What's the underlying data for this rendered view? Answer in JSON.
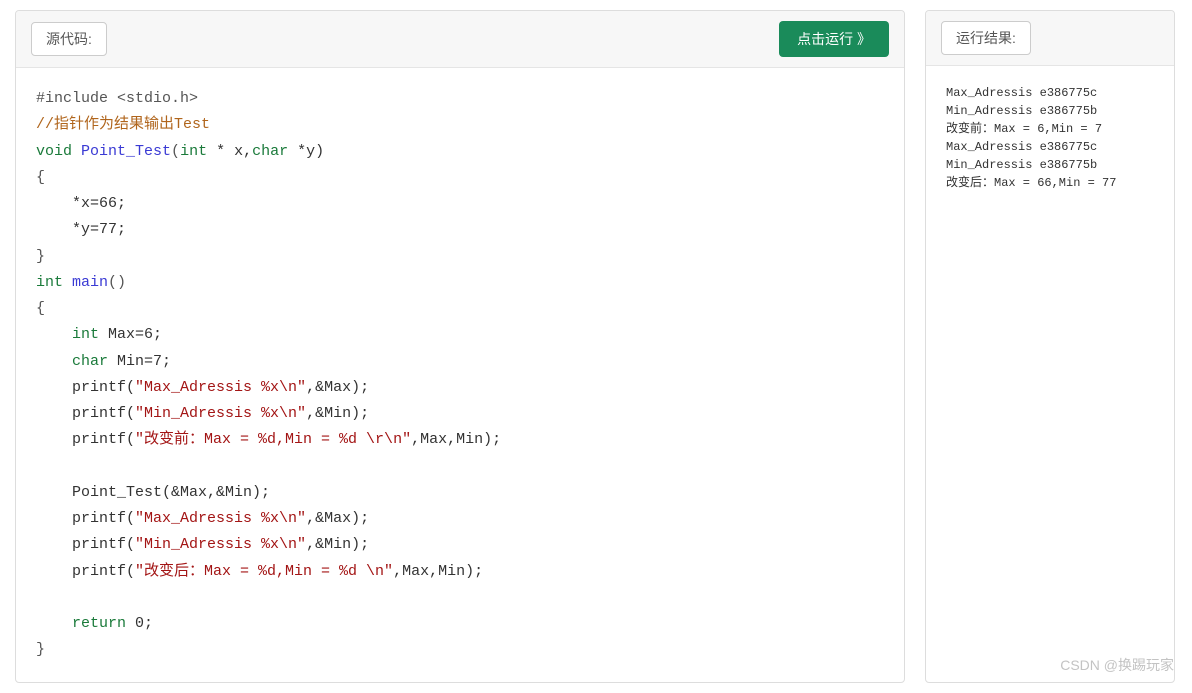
{
  "leftPanel": {
    "sourceLabel": "源代码:",
    "runButtonLabel": "点击运行 》",
    "code": {
      "line1_include": "#include <stdio.h>",
      "line2_comment": "//指针作为结果输出Test",
      "line3_void": "void",
      "line3_func": " Point_Test",
      "line3_paren1": "(",
      "line3_int": "int",
      "line3_star_x": " * x,",
      "line3_char": "char",
      "line3_star_y": " *y)",
      "line4_brace": "{",
      "line5_x66": "    *x=66;",
      "line6_y77": "    *y=77;",
      "line7_brace": "}",
      "line8_int": "int",
      "line8_main": " main",
      "line8_paren": "()",
      "line9_brace": "{",
      "line10_int": "    int",
      "line10_max": " Max=6;",
      "line11_char": "    char",
      "line11_min": " Min=7;",
      "line12_printf": "    printf(",
      "line12_str": "\"Max_Adressis %x\\n\"",
      "line12_end": ",&Max);",
      "line13_printf": "    printf(",
      "line13_str": "\"Min_Adressis %x\\n\"",
      "line13_end": ",&Min);",
      "line14_printf": "    printf(",
      "line14_str": "\"改变前：Max = %d,Min = %d \\r\\n\"",
      "line14_end": ",Max,Min);",
      "line15_blank": "",
      "line16_call": "    Point_Test(&Max,&Min);",
      "line17_printf": "    printf(",
      "line17_str": "\"Max_Adressis %x\\n\"",
      "line17_end": ",&Max);",
      "line18_printf": "    printf(",
      "line18_str": "\"Min_Adressis %x\\n\"",
      "line18_end": ",&Min);",
      "line19_printf": "    printf(",
      "line19_str": "\"改变后：Max = %d,Min = %d \\n\"",
      "line19_end": ",Max,Min);",
      "line20_blank": "",
      "line21_return": "    return",
      "line21_zero": " 0;",
      "line22_brace": "}"
    }
  },
  "rightPanel": {
    "resultLabel": "运行结果:",
    "output": "Max_Adressis e386775c\nMin_Adressis e386775b\n改变前：Max = 6,Min = 7\nMax_Adressis e386775c\nMin_Adressis e386775b\n改变后：Max = 66,Min = 77"
  },
  "watermark": "CSDN @换踢玩家"
}
